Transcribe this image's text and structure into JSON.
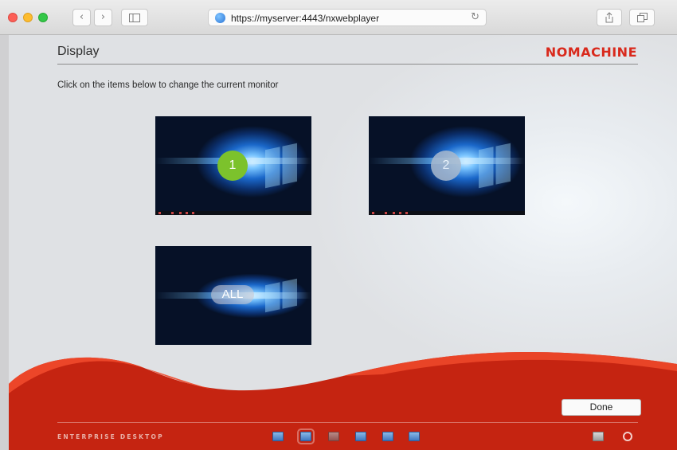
{
  "browser": {
    "url": "https://myserver:4443/nxwebplayer",
    "back_glyph": "‹",
    "forward_glyph": "›",
    "reload_glyph": "↻",
    "icons": [
      "globe-icon",
      "reload-icon",
      "share-icon",
      "tabs-icon",
      "sidebar-icon"
    ]
  },
  "header": {
    "title": "Display",
    "logo": "NOMACHINE"
  },
  "instructions": "Click on the items below to change the current monitor",
  "monitors": [
    {
      "label": "1",
      "selected": true,
      "badge_color": "#7cc22c"
    },
    {
      "label": "2",
      "selected": false,
      "badge_color": "#a9b9cd"
    },
    {
      "label": "ALL",
      "selected": false,
      "badge_color": "#c8c8d2"
    }
  ],
  "footer": {
    "done_label": "Done",
    "edition": "ENTERPRISE DESKTOP",
    "icons": [
      "monitor-icon",
      "display-icon",
      "grid-icon",
      "fit-icon",
      "resize-icon",
      "settings-display-icon",
      "clipboard-icon",
      "disconnect-icon"
    ]
  },
  "colors": {
    "brand": "#d9291c",
    "footer_red": "#c52411",
    "wave_light": "#ef4a2c"
  }
}
